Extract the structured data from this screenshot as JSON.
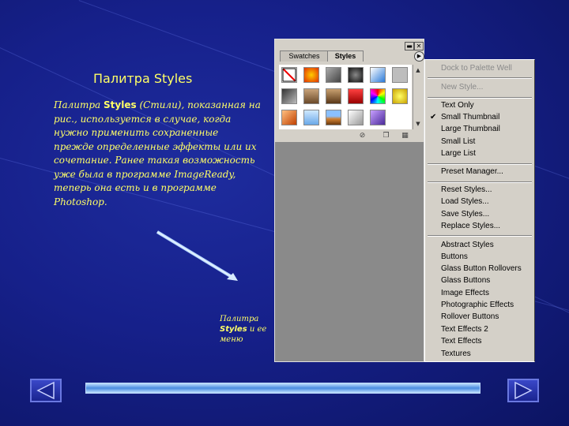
{
  "slide": {
    "title": "Палитра Styles",
    "body_part1": "Палитра ",
    "body_bold": "Styles",
    "body_part2": " (Стили), показанная на рис., используется в случае, когда нужно применить сохраненные прежде определенные эффекты или их сочетание. Ранее такая возможность уже была в программе ImageReady, теперь она есть и в программе Photoshop.",
    "caption_part1": "Палитра ",
    "caption_bold": "Styles",
    "caption_part2": " и ее меню"
  },
  "palette": {
    "tabs": [
      "Swatches",
      "Styles"
    ],
    "active_tab": "Styles",
    "window_buttons": [
      "minimize",
      "close"
    ]
  },
  "menu": {
    "items": [
      {
        "label": "Dock to Palette Well",
        "enabled": false
      },
      {
        "label": "New Style...",
        "enabled": false
      },
      {
        "label": "Text Only",
        "enabled": true
      },
      {
        "label": "Small Thumbnail",
        "enabled": true,
        "checked": true
      },
      {
        "label": "Large Thumbnail",
        "enabled": true
      },
      {
        "label": "Small List",
        "enabled": true
      },
      {
        "label": "Large List",
        "enabled": true
      },
      {
        "label": "Preset Manager...",
        "enabled": true
      },
      {
        "label": "Reset Styles...",
        "enabled": true
      },
      {
        "label": "Load Styles...",
        "enabled": true
      },
      {
        "label": "Save Styles...",
        "enabled": true
      },
      {
        "label": "Replace Styles...",
        "enabled": true
      },
      {
        "label": "Abstract Styles",
        "enabled": true
      },
      {
        "label": "Buttons",
        "enabled": true
      },
      {
        "label": "Glass Button Rollovers",
        "enabled": true
      },
      {
        "label": "Glass Buttons",
        "enabled": true
      },
      {
        "label": "Image Effects",
        "enabled": true
      },
      {
        "label": "Photographic Effects",
        "enabled": true
      },
      {
        "label": "Rollover Buttons",
        "enabled": true
      },
      {
        "label": "Text Effects 2",
        "enabled": true
      },
      {
        "label": "Text Effects",
        "enabled": true
      },
      {
        "label": "Textures",
        "enabled": true
      }
    ]
  },
  "nav": {
    "prev_icon": "triangle-left-icon",
    "next_icon": "triangle-right-icon"
  },
  "colors": {
    "text": "#ffff66",
    "background": "#16208a",
    "progress": "#4a8ce0"
  }
}
